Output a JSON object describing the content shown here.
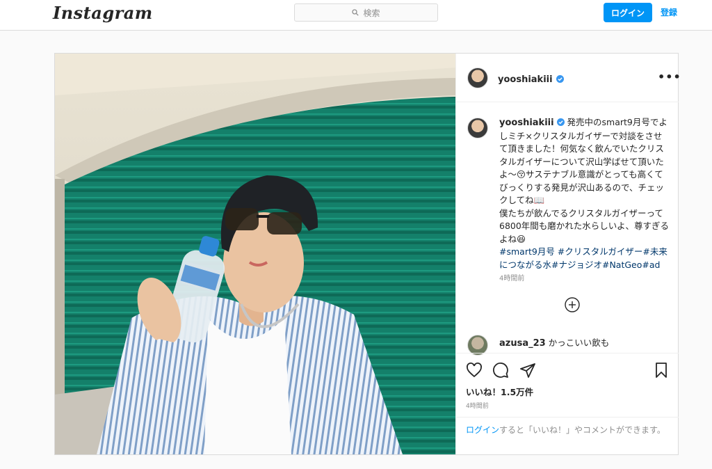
{
  "topbar": {
    "logo": "Instagram",
    "search_placeholder": "検索",
    "login_label": "ログイン",
    "signup_label": "登録"
  },
  "post": {
    "username": "yooshiakiii",
    "more": "•••",
    "caption_text": "発売中のsmart9月号でよしミチ×クリスタルガイザーで対談をさせて頂きました！何気なく飲んでいたクリスタルガイザーについて沢山学ばせて頂いたよ〜😚サステナブル意識がとっても高くてびっくりする発見が沢山あるので、チェックしてね📖",
    "caption_text2": "僕たちが飲んでるクリスタルガイザーって6800年間も磨かれた水らしいよ、尊すぎるよね😆",
    "hashtags": "#smart9月号 #クリスタルガイザー#未来につながる水#ナジョジオ#NatGeo#ad",
    "caption_time": "4時間前",
    "comment_user": "azusa_23",
    "comment_text": "かっこいい飲も",
    "likes": "いいね！1.5万件",
    "post_time": "4時間前",
    "login_link": "ログイン",
    "login_prompt": "すると「いいね！」やコメントができます。"
  },
  "colors": {
    "accent": "#0095f6",
    "hashtag": "#00376b",
    "shutter": "#14806a"
  }
}
